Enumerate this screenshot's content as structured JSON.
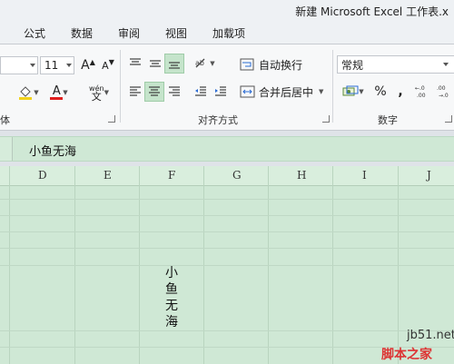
{
  "window": {
    "title": "新建 Microsoft Excel 工作表.x"
  },
  "tabs": [
    {
      "label": "公式"
    },
    {
      "label": "数据"
    },
    {
      "label": "审阅"
    },
    {
      "label": "视图"
    },
    {
      "label": "加载项"
    }
  ],
  "font_group": {
    "font_size": "11",
    "label": "体",
    "increase_glyph": "A",
    "decrease_glyph": "A",
    "font_color_glyph": "A",
    "phonetic_glyph": "wén"
  },
  "alignment_group": {
    "label": "对齐方式",
    "wrap_text": "自动换行",
    "merge_center": "合并后居中"
  },
  "number_group": {
    "label": "数字",
    "format": "常规",
    "percent": "%",
    "comma": ","
  },
  "formula_bar": {
    "content": "小鱼无海"
  },
  "columns": [
    "D",
    "E",
    "F",
    "G",
    "H",
    "I",
    "J"
  ],
  "cell_F": {
    "value": "小\n鱼\n无\n海"
  },
  "watermark": {
    "site": "jb51.net",
    "name": "脚本之家"
  },
  "colors": {
    "selection_green": "#cfe8d5",
    "active_button": "#c5e4cb",
    "font_color_red": "#e01e1e"
  }
}
